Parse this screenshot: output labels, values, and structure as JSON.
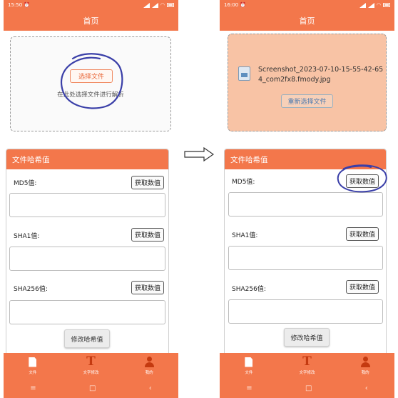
{
  "left": {
    "status": {
      "time": "15:50",
      "alarm_icon": "alarm-clock-icon",
      "icons": [
        "signal-icon",
        "signal-icon",
        "wifi-icon",
        "battery-icon"
      ]
    },
    "title": "首页",
    "upload": {
      "pick_label": "选择文件",
      "hint": "在此处选择文件进行解析"
    },
    "hash": {
      "header": "文件哈希值",
      "md5_label": "MD5值:",
      "sha1_label": "SHA1值:",
      "sha256_label": "SHA256值:",
      "get_label": "获取数值",
      "md5_value": "",
      "sha1_value": "",
      "sha256_value": "",
      "modify_label": "修改哈希值"
    },
    "tabs": [
      {
        "label": "文件",
        "icon": "document-icon"
      },
      {
        "label": "文字修改",
        "icon": "text-t-icon"
      },
      {
        "label": "我的",
        "icon": "person-icon"
      }
    ],
    "nav": {
      "menu": "≡",
      "home": "□",
      "back": "‹"
    }
  },
  "right": {
    "status": {
      "time": "16:00",
      "alarm_icon": "alarm-clock-icon",
      "icons": [
        "signal-icon",
        "signal-icon",
        "wifi-icon",
        "battery-icon"
      ]
    },
    "title": "首页",
    "upload": {
      "file_name": "Screenshot_2023-07-10-15-55-42-654_com2fx8.fmody.jpg",
      "reselect_label": "重新选择文件"
    },
    "hash": {
      "header": "文件哈希值",
      "md5_label": "MD5值:",
      "sha1_label": "SHA1值:",
      "sha256_label": "SHA256值:",
      "get_label": "获取数值",
      "md5_value": "",
      "sha1_value": "",
      "sha256_value": "",
      "modify_label": "修改哈希值"
    },
    "tabs": [
      {
        "label": "文件",
        "icon": "document-icon"
      },
      {
        "label": "文字修改",
        "icon": "text-t-icon"
      },
      {
        "label": "我的",
        "icon": "person-icon"
      }
    ],
    "nav": {
      "menu": "≡",
      "home": "□",
      "back": "‹"
    }
  },
  "colors": {
    "accent": "#f3774b",
    "annotation": "#3a3fa8",
    "selected_box": "#f8c3a5"
  }
}
